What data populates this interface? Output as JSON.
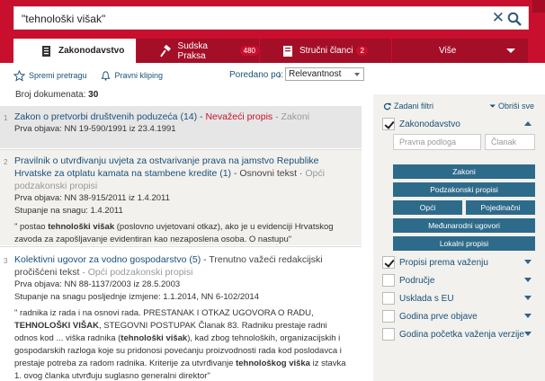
{
  "search": {
    "query": "\"tehnološki višak\""
  },
  "tabs": [
    {
      "label": "Zakonodavstvo",
      "badge": ""
    },
    {
      "label": "Sudska Praksa",
      "badge": "480"
    },
    {
      "label": "Stručni članci",
      "badge": "2"
    },
    {
      "label": "Više",
      "badge": ""
    }
  ],
  "toolbar": {
    "save": "Spremi pretragu",
    "clip": "Pravni kliping",
    "sort_label": "Poredano po:",
    "sort_value": "Relevantnost"
  },
  "count": {
    "label": "Broj dokumenata:",
    "value": "30"
  },
  "results": [
    {
      "num": "1",
      "title": "Zakon o pretvorbi društvenih poduzeća (14)",
      "status": "Nevažeći propis",
      "tag": "Zakoni",
      "meta1": "Prva objava: NN 19-590/1991 iz 23.4.1991"
    },
    {
      "num": "2",
      "title": "Pravilnik o utvrđivanju uvjeta za ostvarivanje prava na jamstvo Republike Hrvatske za otplatu kamata na stambene kredite (1)",
      "status": "Osnovni tekst",
      "tag": "Opći podzakonski propisi",
      "meta1": "Prva objava: NN 38-915/2011 iz 1.4.2011",
      "meta2": "Stupanje na snagu: 1.4.2011",
      "snip_a": "\" postao ",
      "snip_b": "tehnološki višak",
      "snip_c": " (poslovno uvjetovani otkaz), ako je u evidenciji Hrvatskog zavoda za zapošljavanje evidentiran kao nezaposlena osoba. O nastupu\""
    },
    {
      "num": "3",
      "title": "Kolektivni ugovor za vodno gospodarstvo (5)",
      "status": "Trenutno važeći redakcijski pročišćeni tekst",
      "tag": "Opći podzakonski propisi",
      "meta1": "Prva objava: NN 88-1137/2003 iz 28.5.2003",
      "meta2": "Stupanje na snagu posljednje izmjene: 1.1.2014, NN 6-102/2014",
      "snip_a": "\" radnika iz rada i na osnovi rada. PRESTANAK I OTKAZ UGOVORA O RADU, ",
      "snip_b": "TEHNOLOŠKI VIŠAK",
      "snip_c": ", STEGOVNI POSTUPAK Članak 83. Radniku prestaje radni odnos kod ... viška radnika (",
      "snip_d": "tehnološki višak",
      "snip_e": "), kad zbog tehnoloških, organizacijskih i gospodarskih razloga koje su pridonosi povećanju proizvodnosti rada kod poslodavca i prestaje potreba za radom radnika. Kriterije za utvrđivanje ",
      "snip_f": "tehnološkog viška",
      "snip_g": " iz stavka 1. ovog članka utvrđuju suglasno generalni direktor\""
    }
  ],
  "side": {
    "filters_label": "Zadani filtri",
    "clear_label": "Obriši sve",
    "main_filter": "Zakonodavstvo",
    "inp1": "Pravna podloga",
    "inp2": "Članak",
    "btns": [
      "Zakoni",
      "Podzakonski propisi",
      "Opći",
      "Pojedinačni",
      "Međunarodni ugovori",
      "Lokalni propisi"
    ],
    "filters": [
      "Propisi prema važenju",
      "Područje",
      "Usklada s EU",
      "Godina prve objave",
      "Godina početka važenja verzije"
    ]
  }
}
